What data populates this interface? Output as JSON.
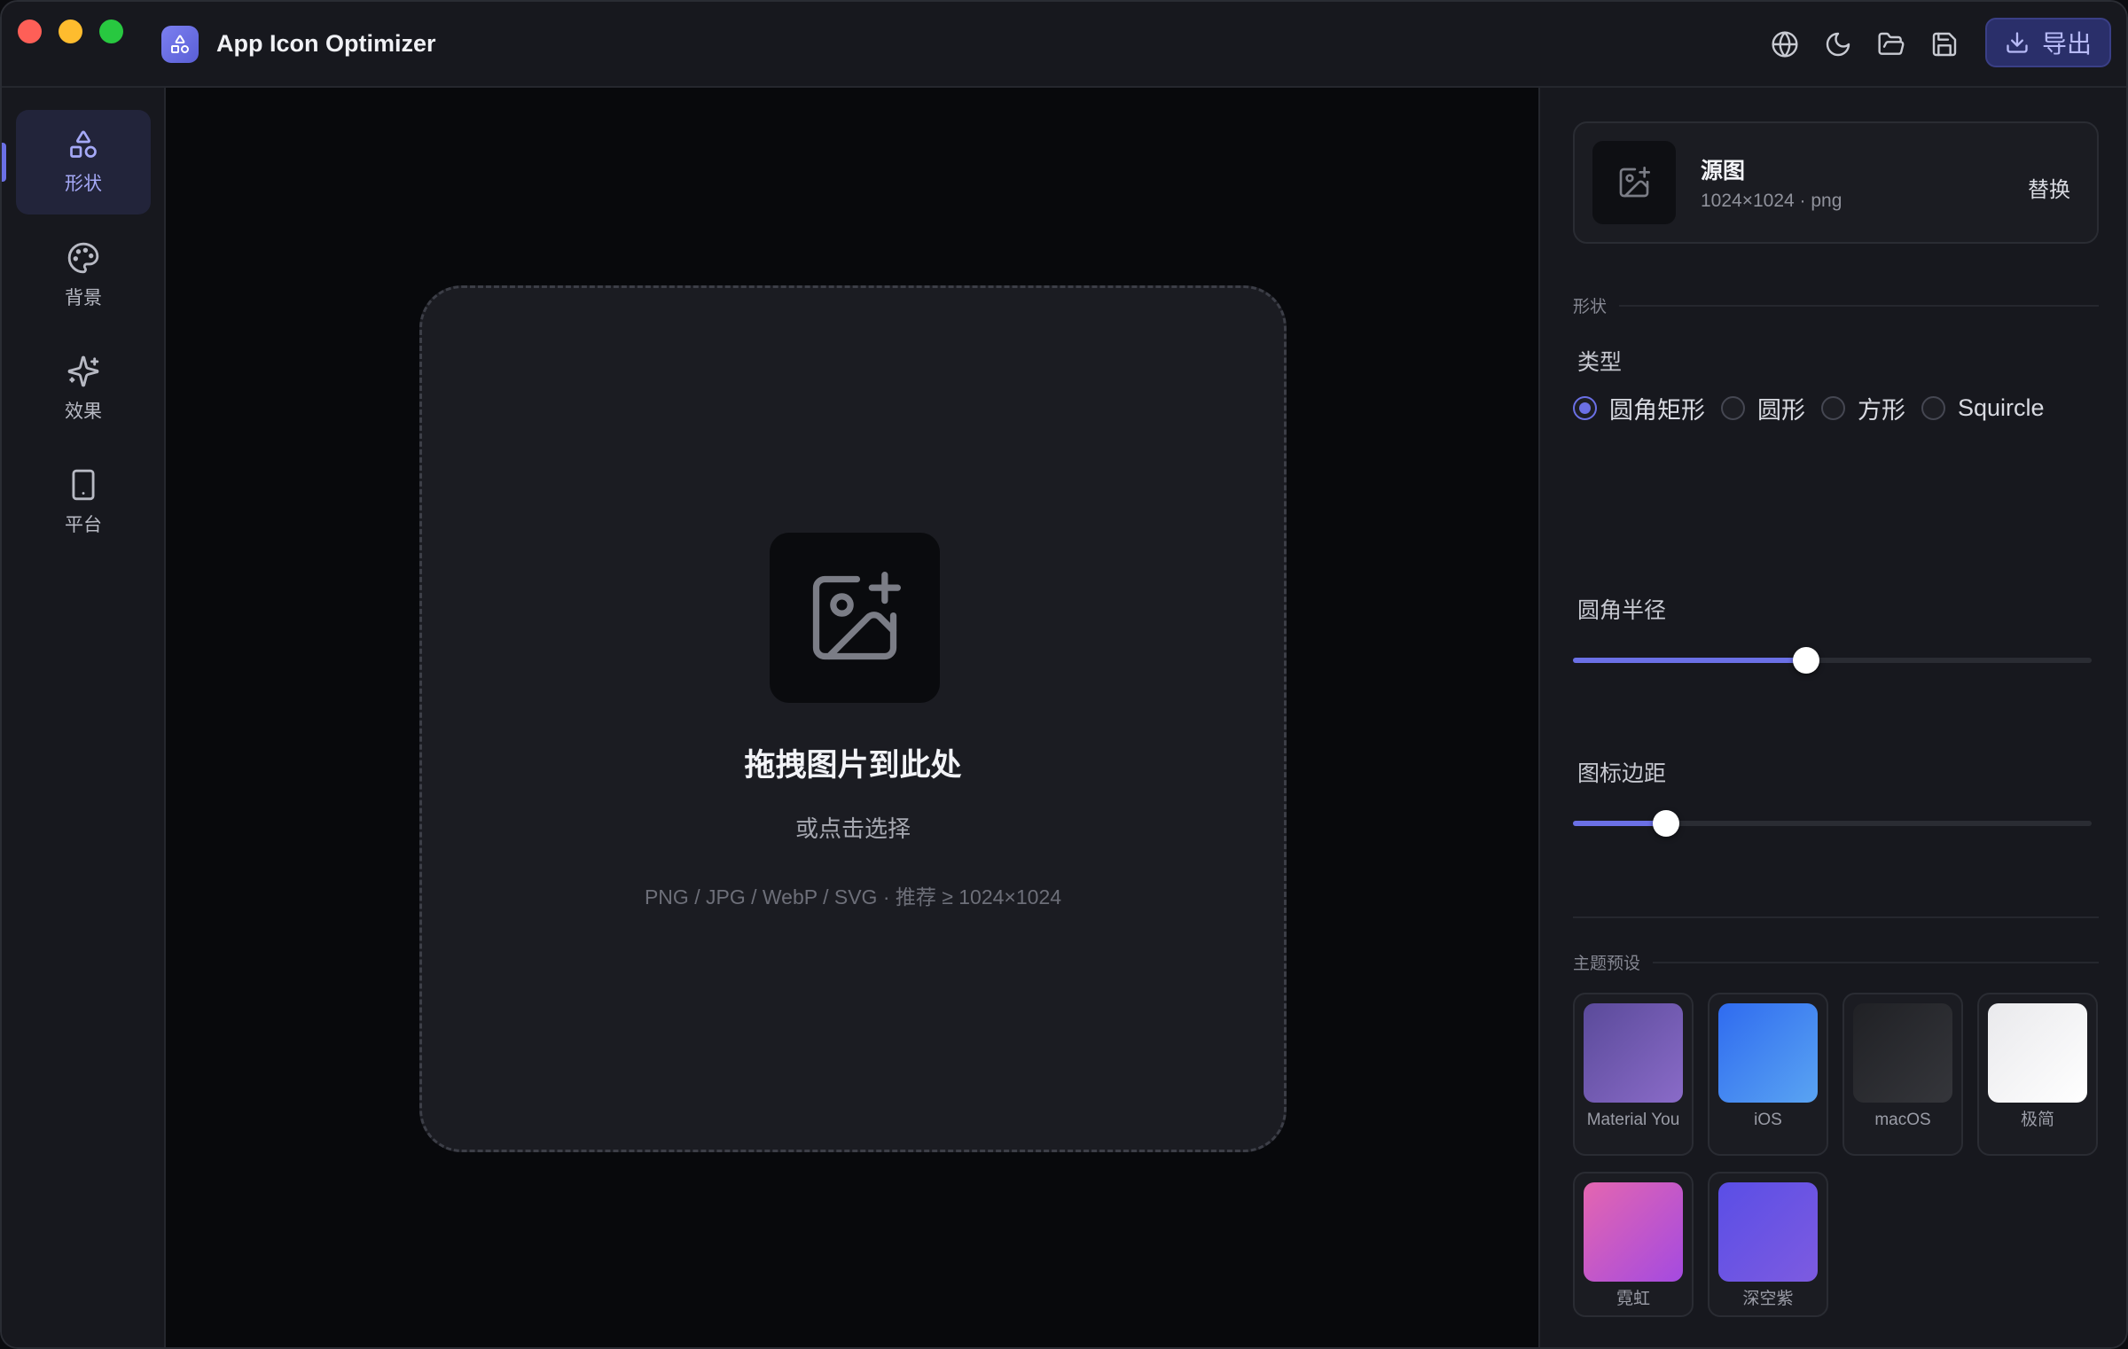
{
  "window": {
    "title": "App Icon Optimizer",
    "export_label": "导出"
  },
  "sidebar": {
    "items": [
      {
        "label": "形状",
        "icon": "shapes-icon",
        "active": true
      },
      {
        "label": "背景",
        "icon": "palette-icon",
        "active": false
      },
      {
        "label": "效果",
        "icon": "sparkles-icon",
        "active": false
      },
      {
        "label": "平台",
        "icon": "smartphone-icon",
        "active": false
      }
    ]
  },
  "toolbar": {
    "icons": [
      "globe-icon",
      "moon-icon",
      "folder-open-icon",
      "save-icon"
    ]
  },
  "dropzone": {
    "title": "拖拽图片到此处",
    "subtitle": "或点击选择",
    "hint": "PNG / JPG / WebP / SVG · 推荐 ≥ 1024×1024"
  },
  "panel": {
    "source": {
      "title": "源图",
      "meta": "1024×1024 · png",
      "replace_label": "替换"
    },
    "shape_section": "形状",
    "type_label": "类型",
    "shape_options": [
      {
        "label": "圆角矩形",
        "selected": true
      },
      {
        "label": "圆形",
        "selected": false
      },
      {
        "label": "方形",
        "selected": false
      },
      {
        "label": "Squircle",
        "selected": false
      }
    ],
    "corner_radius": {
      "label": "圆角半径",
      "value": 0.45
    },
    "icon_padding": {
      "label": "图标边距",
      "value": 0.18
    },
    "presets_section": "主题预设",
    "presets": [
      {
        "label": "Material You",
        "gradient": [
          "#5a4a9a",
          "#8a6bc8"
        ]
      },
      {
        "label": "iOS",
        "gradient": [
          "#2f6bf0",
          "#5aa4f2"
        ]
      },
      {
        "label": "macOS",
        "gradient": [
          "#202125",
          "#35363b"
        ]
      },
      {
        "label": "极简",
        "gradient": [
          "#e9e9ec",
          "#ffffff"
        ]
      },
      {
        "label": "霓虹",
        "gradient": [
          "#e466b0",
          "#a44ae0"
        ]
      },
      {
        "label": "深空紫",
        "gradient": [
          "#5a4ee6",
          "#7d5be0"
        ]
      }
    ]
  },
  "colors": {
    "accent": "#6b70e6",
    "panel_bg": "#17181e",
    "canvas_bg": "#08090c"
  }
}
